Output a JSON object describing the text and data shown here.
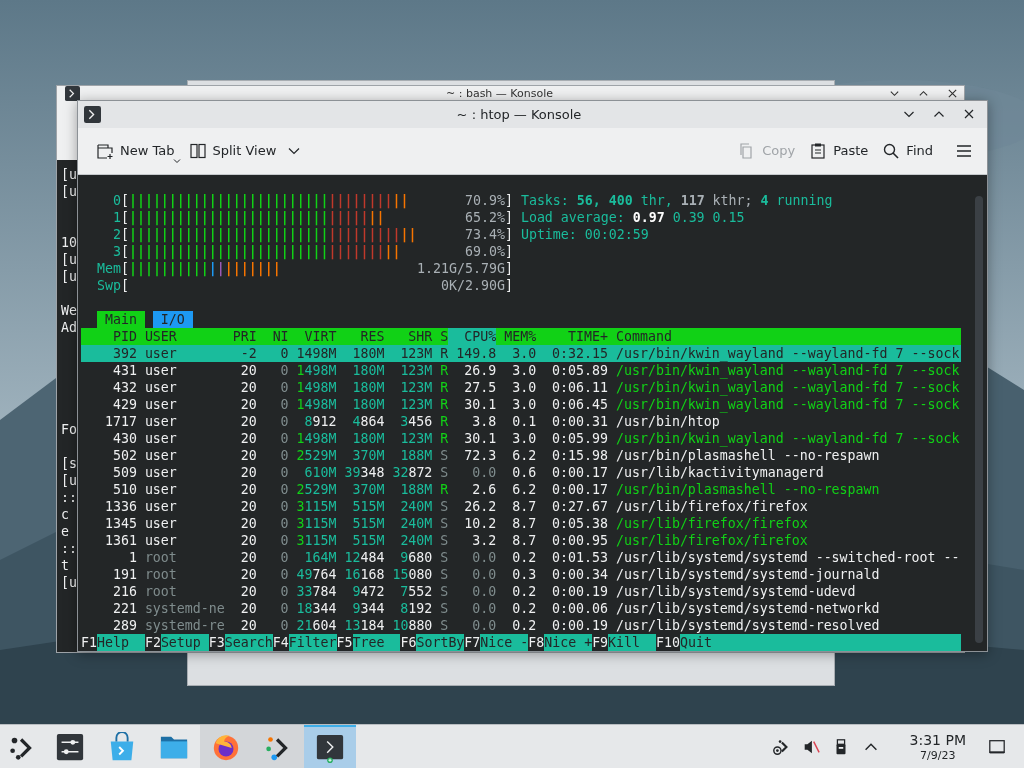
{
  "back_window": {
    "title": "~ : bash — Konsole",
    "lines": [
      "[u",
      "[u",
      "10",
      "[u",
      "[u",
      "We",
      "Ad",
      "Fo",
      "[s",
      "[u",
      "::",
      "c",
      "e",
      "::",
      "t",
      "[u"
    ]
  },
  "window": {
    "title": "~ : htop — Konsole"
  },
  "toolbar": {
    "left": [
      {
        "label": "New Tab",
        "kind": "newtab"
      },
      {
        "label": "Split View",
        "kind": "split"
      }
    ],
    "right": [
      {
        "label": "Copy",
        "kind": "copy",
        "disabled": true
      },
      {
        "label": "Paste",
        "kind": "paste",
        "disabled": false
      },
      {
        "label": "Find",
        "kind": "find",
        "disabled": false
      }
    ]
  },
  "meters": [
    {
      "label": "0",
      "open": "[",
      "close": "]",
      "reading": "70.9%",
      "segments": [
        {
          "color": "#11d116",
          "bars": "|||||||||||||||||||||||||"
        },
        {
          "color": "#c0392b",
          "bars": "||||||||"
        },
        {
          "color": "#f67400",
          "bars": "||"
        }
      ]
    },
    {
      "label": "1",
      "open": "[",
      "close": "]",
      "reading": "65.2%",
      "segments": [
        {
          "color": "#11d116",
          "bars": "|||||||||||||||||||||||||"
        },
        {
          "color": "#c0392b",
          "bars": "|||||"
        },
        {
          "color": "#f67400",
          "bars": "||"
        }
      ]
    },
    {
      "label": "2",
      "open": "[",
      "close": "]",
      "reading": "73.4%",
      "segments": [
        {
          "color": "#11d116",
          "bars": "|||||||||||||||||||||||||"
        },
        {
          "color": "#c0392b",
          "bars": "|||||||||"
        },
        {
          "color": "#f67400",
          "bars": "||"
        }
      ]
    },
    {
      "label": "3",
      "open": "[",
      "close": "]",
      "reading": "69.0%",
      "segments": [
        {
          "color": "#11d116",
          "bars": "|||||||||||||||||||||||||"
        },
        {
          "color": "#c0392b",
          "bars": "|||||||"
        },
        {
          "color": "#f67400",
          "bars": "||"
        }
      ]
    },
    {
      "label": "Mem",
      "open": "[",
      "close": "]",
      "reading": "1.21G/5.79G",
      "segments": [
        {
          "color": "#11d116",
          "bars": "||||||||||"
        },
        {
          "color": "#1d99f3",
          "bars": "|"
        },
        {
          "color": "#9b59b6",
          "bars": "|"
        },
        {
          "color": "#f67400",
          "bars": "|||||||"
        }
      ]
    },
    {
      "label": "Swp",
      "open": "[",
      "close": "]",
      "reading": "0K/2.90G"
    }
  ],
  "info": [
    [
      {
        "text": "Tasks:",
        "kind": "label"
      },
      {
        "text": "56,",
        "kind": "value"
      },
      {
        "text": "400",
        "kind": "value"
      },
      {
        "text": "thr,",
        "kind": "label"
      },
      {
        "text": "117",
        "kind": "muted_value"
      },
      {
        "text": "kthr;",
        "kind": "muted"
      },
      {
        "text": "4",
        "kind": "value"
      },
      {
        "text": "running",
        "kind": "label"
      }
    ],
    [
      {
        "text": "Load average:",
        "kind": "label"
      },
      {
        "text": "0.97",
        "kind": "bright"
      },
      {
        "text": "0.39",
        "kind": "label"
      },
      {
        "text": "0.15",
        "kind": "label"
      }
    ],
    [
      {
        "text": "Uptime:",
        "kind": "label"
      },
      {
        "text": "00:02:59",
        "kind": "label"
      }
    ]
  ],
  "tabs": [
    {
      "label": "Main",
      "selected": true
    },
    {
      "label": "I/O",
      "selected": false
    }
  ],
  "table": {
    "columns": [
      {
        "label": "PID",
        "selected": false
      },
      {
        "label": "USER",
        "selected": false
      },
      {
        "label": "PRI",
        "selected": false
      },
      {
        "label": "NI",
        "selected": false
      },
      {
        "label": "VIRT",
        "selected": false
      },
      {
        "label": "RES",
        "selected": false
      },
      {
        "label": "SHR",
        "selected": false
      },
      {
        "label": "S",
        "selected": false
      },
      {
        "label": "CPU%",
        "selected": true
      },
      {
        "label": "MEM%",
        "selected": false
      },
      {
        "label": "TIME+",
        "selected": false
      },
      {
        "label": "Command",
        "selected": false
      }
    ],
    "rows": [
      {
        "pid": "392",
        "user": "user",
        "pri": "-2",
        "ni": "0",
        "virt": "1498M",
        "res": "180M",
        "shr": "123M",
        "s": "R",
        "cpu": "149.8",
        "mem": "3.0",
        "time": "0:32.15",
        "command": "/usr/bin/kwin_wayland --wayland-fd 7 --sock",
        "selected": true
      },
      {
        "pid": "431",
        "user": "user",
        "pri": "20",
        "ni": "0",
        "virt": "1498M",
        "res": "180M",
        "shr": "123M",
        "s": "R",
        "cpu": "26.9",
        "mem": "3.0",
        "time": "0:05.89",
        "command": "/usr/bin/kwin_wayland --wayland-fd 7 --sock",
        "selected": false,
        "thread": true,
        "own": true,
        "running": true,
        "idle": false
      },
      {
        "pid": "432",
        "user": "user",
        "pri": "20",
        "ni": "0",
        "virt": "1498M",
        "res": "180M",
        "shr": "123M",
        "s": "R",
        "cpu": "27.5",
        "mem": "3.0",
        "time": "0:06.11",
        "command": "/usr/bin/kwin_wayland --wayland-fd 7 --sock",
        "selected": false,
        "thread": true,
        "own": true,
        "running": true,
        "idle": false
      },
      {
        "pid": "429",
        "user": "user",
        "pri": "20",
        "ni": "0",
        "virt": "1498M",
        "res": "180M",
        "shr": "123M",
        "s": "R",
        "cpu": "30.1",
        "mem": "3.0",
        "time": "0:06.45",
        "command": "/usr/bin/kwin_wayland --wayland-fd 7 --sock",
        "selected": false,
        "thread": true,
        "own": true,
        "running": true,
        "idle": false
      },
      {
        "pid": "1717",
        "user": "user",
        "pri": "20",
        "ni": "0",
        "virt": "8912",
        "res": "4864",
        "shr": "3456",
        "s": "R",
        "cpu": "3.8",
        "mem": "0.1",
        "time": "0:00.31",
        "command": "/usr/bin/htop",
        "selected": false,
        "thread": false,
        "own": true,
        "running": true,
        "idle": false
      },
      {
        "pid": "430",
        "user": "user",
        "pri": "20",
        "ni": "0",
        "virt": "1498M",
        "res": "180M",
        "shr": "123M",
        "s": "R",
        "cpu": "30.1",
        "mem": "3.0",
        "time": "0:05.99",
        "command": "/usr/bin/kwin_wayland --wayland-fd 7 --sock",
        "selected": false,
        "thread": true,
        "own": true,
        "running": true,
        "idle": false
      },
      {
        "pid": "502",
        "user": "user",
        "pri": "20",
        "ni": "0",
        "virt": "2529M",
        "res": "370M",
        "shr": "188M",
        "s": "S",
        "cpu": "72.3",
        "mem": "6.2",
        "time": "0:15.98",
        "command": "/usr/bin/plasmashell --no-respawn",
        "selected": false,
        "thread": false,
        "own": true,
        "running": false,
        "idle": false
      },
      {
        "pid": "509",
        "user": "user",
        "pri": "20",
        "ni": "0",
        "virt": "610M",
        "res": "39348",
        "shr": "32872",
        "s": "S",
        "cpu": "0.0",
        "mem": "0.6",
        "time": "0:00.17",
        "command": "/usr/lib/kactivitymanagerd",
        "selected": false,
        "thread": false,
        "own": true,
        "running": false,
        "idle": true
      },
      {
        "pid": "510",
        "user": "user",
        "pri": "20",
        "ni": "0",
        "virt": "2529M",
        "res": "370M",
        "shr": "188M",
        "s": "R",
        "cpu": "2.6",
        "mem": "6.2",
        "time": "0:00.17",
        "command": "/usr/bin/plasmashell --no-respawn",
        "selected": false,
        "thread": true,
        "own": true,
        "running": true,
        "idle": false
      },
      {
        "pid": "1336",
        "user": "user",
        "pri": "20",
        "ni": "0",
        "virt": "3115M",
        "res": "515M",
        "shr": "240M",
        "s": "S",
        "cpu": "26.2",
        "mem": "8.7",
        "time": "0:27.67",
        "command": "/usr/lib/firefox/firefox",
        "selected": false,
        "thread": false,
        "own": true,
        "running": false,
        "idle": false
      },
      {
        "pid": "1345",
        "user": "user",
        "pri": "20",
        "ni": "0",
        "virt": "3115M",
        "res": "515M",
        "shr": "240M",
        "s": "S",
        "cpu": "10.2",
        "mem": "8.7",
        "time": "0:05.38",
        "command": "/usr/lib/firefox/firefox",
        "selected": false,
        "thread": true,
        "own": true,
        "running": false,
        "idle": false
      },
      {
        "pid": "1361",
        "user": "user",
        "pri": "20",
        "ni": "0",
        "virt": "3115M",
        "res": "515M",
        "shr": "240M",
        "s": "S",
        "cpu": "3.2",
        "mem": "8.7",
        "time": "0:00.95",
        "command": "/usr/lib/firefox/firefox",
        "selected": false,
        "thread": true,
        "own": true,
        "running": false,
        "idle": false
      },
      {
        "pid": "1",
        "user": "root",
        "pri": "20",
        "ni": "0",
        "virt": "164M",
        "res": "12484",
        "shr": "9680",
        "s": "S",
        "cpu": "0.0",
        "mem": "0.2",
        "time": "0:01.53",
        "command": "/usr/lib/systemd/systemd --switched-root --",
        "selected": false,
        "thread": false,
        "own": false,
        "running": false,
        "idle": true
      },
      {
        "pid": "191",
        "user": "root",
        "pri": "20",
        "ni": "0",
        "virt": "49764",
        "res": "16168",
        "shr": "15080",
        "s": "S",
        "cpu": "0.0",
        "mem": "0.3",
        "time": "0:00.34",
        "command": "/usr/lib/systemd/systemd-journald",
        "selected": false,
        "thread": false,
        "own": false,
        "running": false,
        "idle": true
      },
      {
        "pid": "216",
        "user": "root",
        "pri": "20",
        "ni": "0",
        "virt": "33784",
        "res": "9472",
        "shr": "7552",
        "s": "S",
        "cpu": "0.0",
        "mem": "0.2",
        "time": "0:00.19",
        "command": "/usr/lib/systemd/systemd-udevd",
        "selected": false,
        "thread": false,
        "own": false,
        "running": false,
        "idle": true
      },
      {
        "pid": "221",
        "user": "systemd-ne",
        "pri": "20",
        "ni": "0",
        "virt": "18344",
        "res": "9344",
        "shr": "8192",
        "s": "S",
        "cpu": "0.0",
        "mem": "0.2",
        "time": "0:00.06",
        "command": "/usr/lib/systemd/systemd-networkd",
        "selected": false,
        "thread": false,
        "own": false,
        "running": false,
        "idle": true
      },
      {
        "pid": "289",
        "user": "systemd-re",
        "pri": "20",
        "ni": "0",
        "virt": "21604",
        "res": "13184",
        "shr": "10880",
        "s": "S",
        "cpu": "0.0",
        "mem": "0.2",
        "time": "0:00.19",
        "command": "/usr/lib/systemd/systemd-resolved",
        "selected": false,
        "thread": false,
        "own": false,
        "running": false,
        "idle": true
      }
    ]
  },
  "function_keys": [
    {
      "key": "F1",
      "label": "Help"
    },
    {
      "key": "F2",
      "label": "Setup"
    },
    {
      "key": "F3",
      "label": "Search"
    },
    {
      "key": "F4",
      "label": "Filter"
    },
    {
      "key": "F5",
      "label": "Tree"
    },
    {
      "key": "F6",
      "label": "SortBy"
    },
    {
      "key": "F7",
      "label": "Nice -"
    },
    {
      "key": "F8",
      "label": "Nice +"
    },
    {
      "key": "F9",
      "label": "Kill"
    },
    {
      "key": "F10",
      "label": "Quit"
    }
  ],
  "taskbar": {
    "apps": [
      {
        "kind": "launcher",
        "running": false,
        "selected": false
      },
      {
        "kind": "settings",
        "running": false,
        "selected": false
      },
      {
        "kind": "store",
        "running": false,
        "selected": false
      },
      {
        "kind": "files",
        "running": false,
        "selected": false
      },
      {
        "kind": "browser",
        "running": true,
        "selected": false
      },
      {
        "kind": "connect",
        "running": true,
        "selected": false
      },
      {
        "kind": "terminal",
        "running": true,
        "selected": true
      }
    ],
    "clock": {
      "time": "3:31 PM",
      "date": "7/9/23"
    }
  }
}
